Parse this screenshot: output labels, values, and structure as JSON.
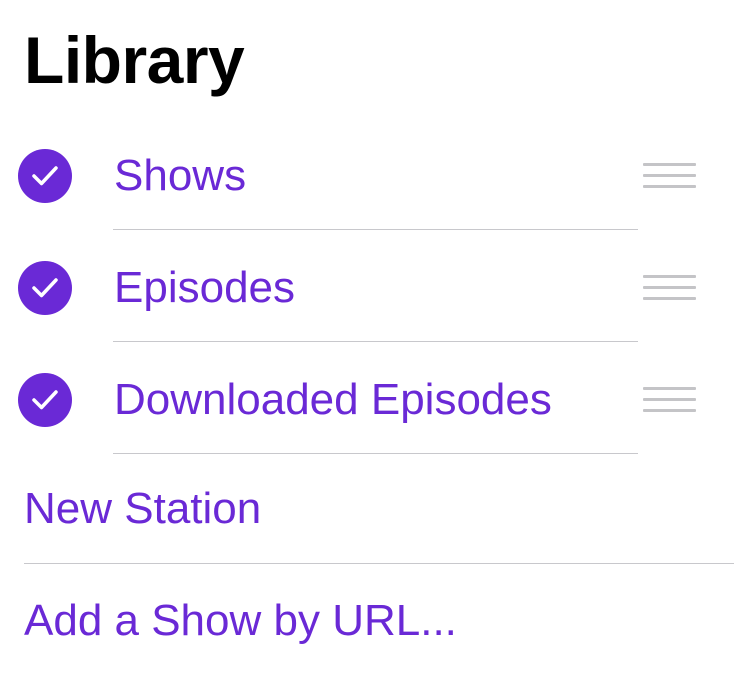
{
  "header": {
    "title": "Library"
  },
  "library_items": [
    {
      "label": "Shows",
      "checked": true
    },
    {
      "label": "Episodes",
      "checked": true
    },
    {
      "label": "Downloaded Episodes",
      "checked": true
    }
  ],
  "actions": {
    "new_station": "New Station",
    "add_show_by_url": "Add a Show by URL..."
  },
  "icons": {
    "check": "checkmark-circle-icon",
    "reorder": "reorder-grip-icon"
  },
  "colors": {
    "accent": "#6a29d6",
    "separator": "#c8c8cc",
    "grip": "#c4c4c7"
  }
}
